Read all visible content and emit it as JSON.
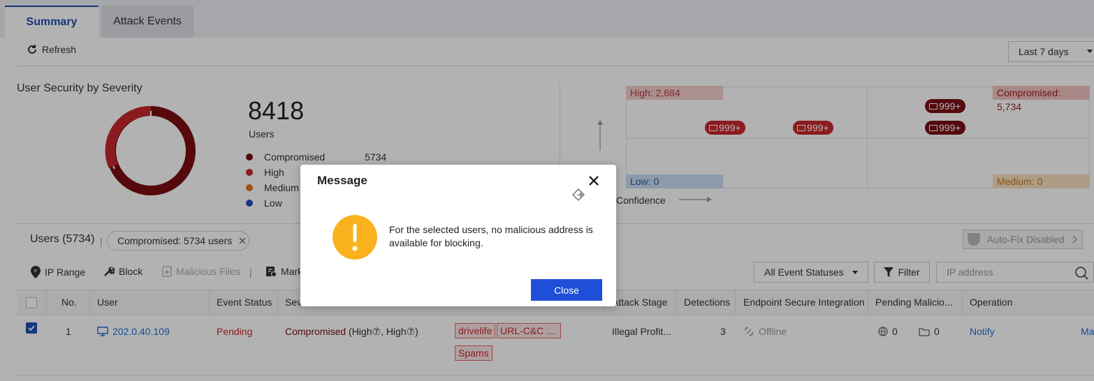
{
  "tabs": [
    {
      "label": "Summary"
    },
    {
      "label": "Attack Events"
    }
  ],
  "toolbar": {
    "refresh_label": "Refresh",
    "date_range": "Last 7 days"
  },
  "severity": {
    "title": "User Security by Severity",
    "total": "8418",
    "total_label": "Users",
    "legend": [
      {
        "name": "Compromised",
        "value": "5734",
        "color": "#7a0d12"
      },
      {
        "name": "High",
        "value": "",
        "color": "#c9272d"
      },
      {
        "name": "Medium",
        "value": "",
        "color": "#e07a1a"
      },
      {
        "name": "Low",
        "value": "",
        "color": "#1f4eb4"
      }
    ]
  },
  "quadrant": {
    "high": "High: 2,684",
    "compromised": "Compromised: 5,734",
    "low": "Low: 0",
    "medium": "Medium: 0",
    "x_axis": "Confidence",
    "pills": [
      "999+",
      "999+",
      "999+",
      "999+"
    ]
  },
  "users": {
    "title": "Users (5734)",
    "filter_tag": "Compromised: 5734 users",
    "autofix": "Auto-Fix Disabled"
  },
  "actions": {
    "ip_range": "IP Range",
    "block": "Block",
    "malicious_files": "Malicious Files",
    "mark": "Mark",
    "status_select": "All Event Statuses",
    "filter": "Filter",
    "search_placeholder": "IP address"
  },
  "table": {
    "headers": [
      "No.",
      "User",
      "Event Status",
      "Sev",
      "",
      "Attack Stage",
      "Detections",
      "Endpoint Secure Integration",
      "Pending Malicio...",
      "Operation"
    ],
    "rows": [
      {
        "no": "1",
        "user": "202.0.40.109",
        "status": "Pending",
        "severity_main": "Compromised",
        "severity_detail": " (High⑦, High⑦)",
        "tags": [
          "drivelife",
          "URL-C&C ...",
          "Spams"
        ],
        "attack_stage": "Illegal Profit...",
        "detections": "3",
        "endpoint": "Offline",
        "pending_a": "0",
        "pending_b": "0",
        "operation": "Notify",
        "operation_more": "Ma"
      }
    ]
  },
  "modal": {
    "title": "Message",
    "message": "For the selected users, no malicious address is available for blocking.",
    "close_label": "Close"
  }
}
